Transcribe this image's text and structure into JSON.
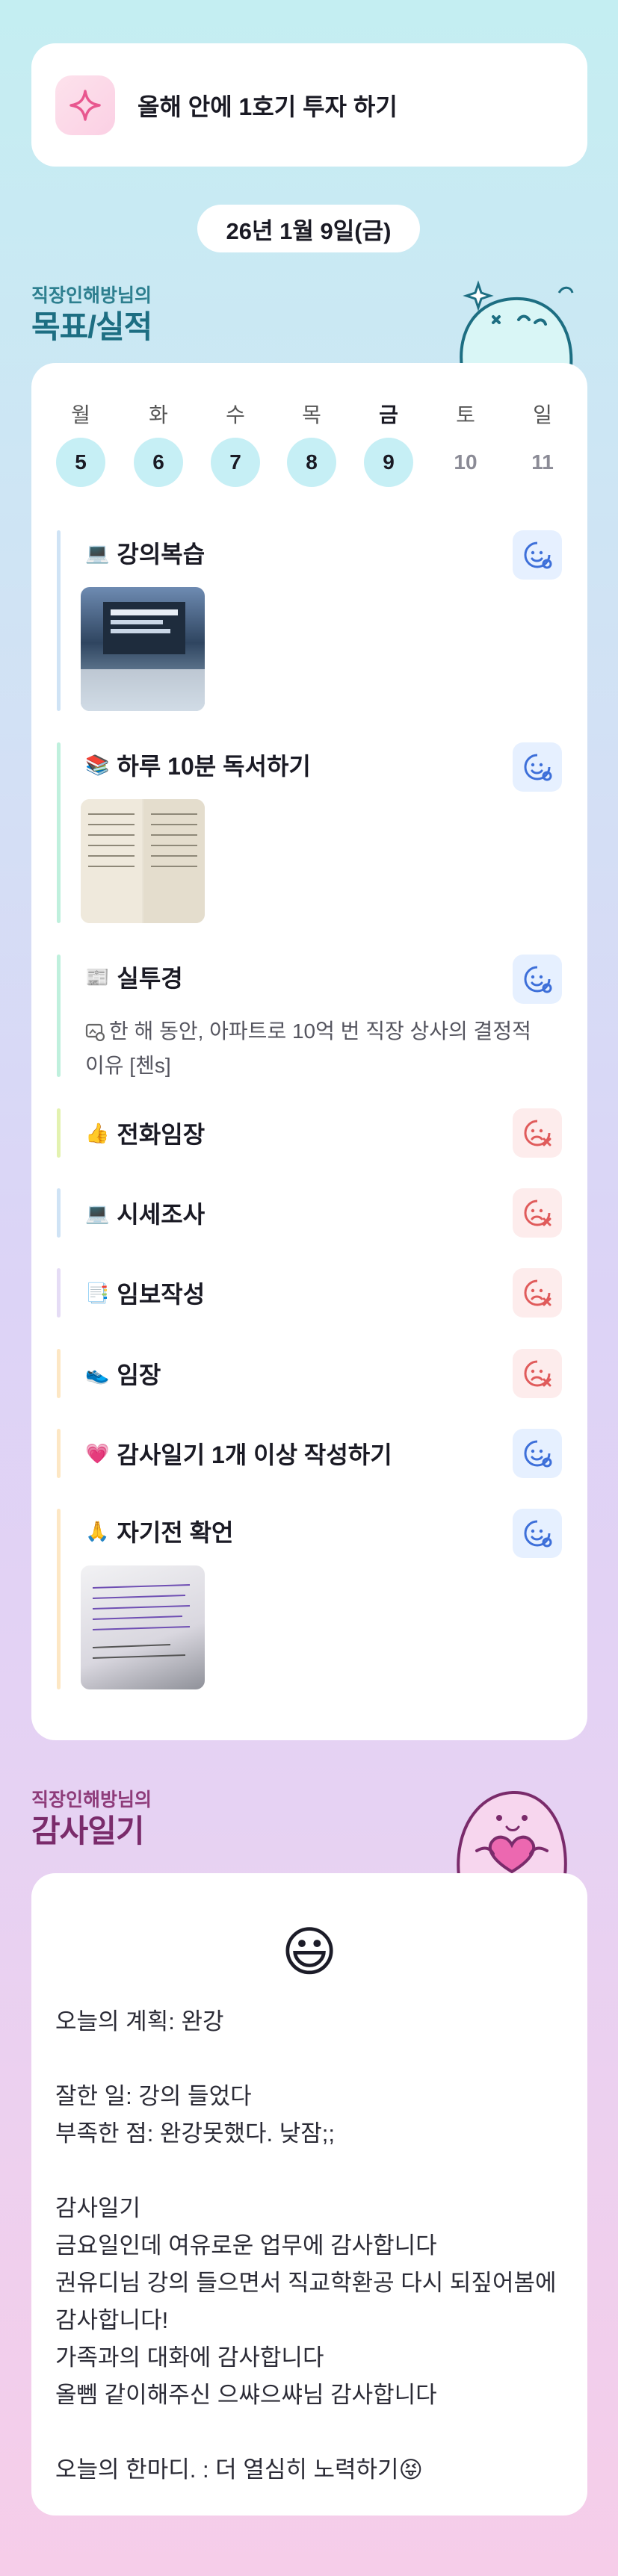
{
  "goal": {
    "text": "올해 안에 1호기 투자 하기",
    "icon": "sparkle-icon"
  },
  "date_label": "26년 1월 9일(금)",
  "goals_section": {
    "subtitle": "직장인해방님의",
    "title": "목표/실적"
  },
  "week": [
    {
      "weekday": "월",
      "day": "5",
      "done": true,
      "today": false
    },
    {
      "weekday": "화",
      "day": "6",
      "done": true,
      "today": false
    },
    {
      "weekday": "수",
      "day": "7",
      "done": true,
      "today": false
    },
    {
      "weekday": "목",
      "day": "8",
      "done": true,
      "today": false
    },
    {
      "weekday": "금",
      "day": "9",
      "done": true,
      "today": true
    },
    {
      "weekday": "토",
      "day": "10",
      "done": false,
      "today": false
    },
    {
      "weekday": "일",
      "day": "11",
      "done": false,
      "today": false
    }
  ],
  "tasks": [
    {
      "emoji": "💻",
      "label": "강의복습",
      "status": "done",
      "bar_color": "#cfe3f5",
      "has_photo": true
    },
    {
      "emoji": "📚",
      "label": "하루 10분 독서하기",
      "status": "done",
      "bar_color": "#bff0dd",
      "has_photo": true
    },
    {
      "emoji": "📰",
      "label": "실투경",
      "status": "done",
      "bar_color": "#bff0dd",
      "link_text": "한 해 동안, 아파트로 10억 번 직장 상사의 결정적 이유 [첸s]"
    },
    {
      "emoji": "👍",
      "label": "전화임장",
      "status": "missed",
      "bar_color": "#e3f2b0"
    },
    {
      "emoji": "💻",
      "label": "시세조사",
      "status": "missed",
      "bar_color": "#cfe3f5"
    },
    {
      "emoji": "📑",
      "label": "임보작성",
      "status": "missed",
      "bar_color": "#e5dcf5"
    },
    {
      "emoji": "👟",
      "label": "임장",
      "status": "missed",
      "bar_color": "#fde7c4"
    },
    {
      "emoji": "💗",
      "label": "감사일기 1개 이상 작성하기",
      "status": "done",
      "bar_color": "#fde7c4"
    },
    {
      "emoji": "🙏",
      "label": "자기전 확언",
      "status": "done",
      "bar_color": "#fde7c4",
      "has_photo": true
    }
  ],
  "diary_section": {
    "subtitle": "직장인해방님의",
    "title": "감사일기"
  },
  "diary": {
    "mood_emoji": "😃",
    "text": "오늘의 계획: 완강\n\n잘한 일: 강의 들었다\n부족한 점: 완강못했다. 낮잠;;\n\n감사일기\n금요일인데 여유로운 업무에 감사합니다\n권유디님 강의 들으면서 직교학환공 다시 되짚어봄에 감사합니다!\n가족과의 대화에 감사합니다\n올뻼 같이해주신 으쌰으쌰님 감사합니다\n\n오늘의 한마디. : 더 열심히 노력하기😝"
  },
  "colors": {
    "accent_teal": "#1d6e82",
    "accent_plum": "#7a2b6b",
    "ok_blue": "#3d6fd9",
    "ng_red": "#e05b5b"
  }
}
